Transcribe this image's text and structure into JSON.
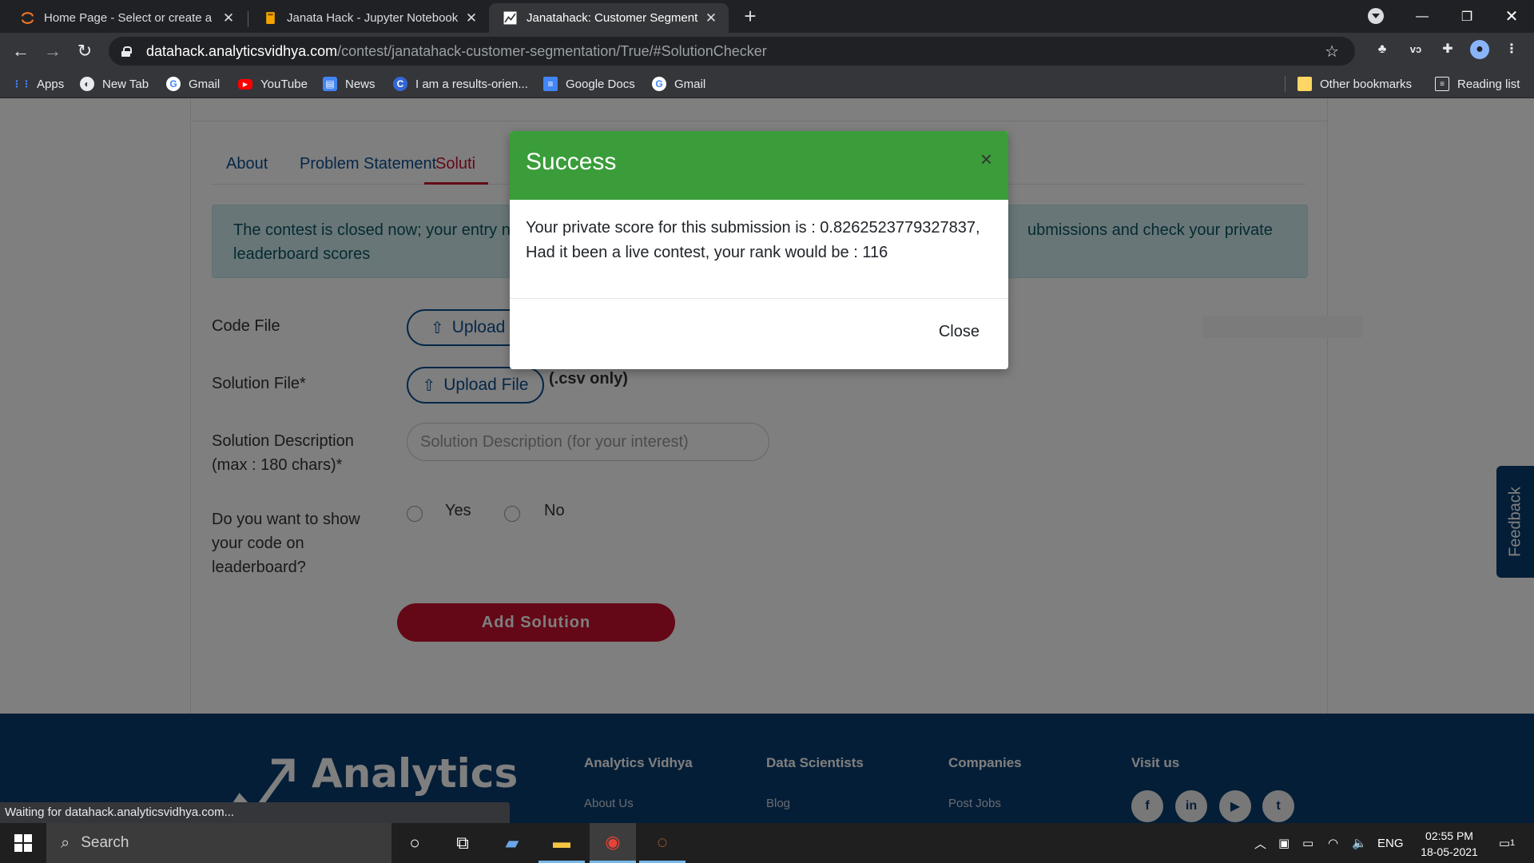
{
  "browser": {
    "tabs": [
      {
        "title": "Home Page - Select or create a n",
        "active": false
      },
      {
        "title": "Janata Hack - Jupyter Notebook",
        "active": false
      },
      {
        "title": "Janatahack: Customer Segmentat",
        "active": true
      }
    ],
    "url_host": "datahack.analyticsvidhya.com",
    "url_path": "/contest/janatahack-customer-segmentation/True/#SolutionChecker",
    "bookmarks": [
      "Apps",
      "New Tab",
      "Gmail",
      "YouTube",
      "News",
      "I am a results-orien...",
      "Google Docs",
      "Gmail"
    ],
    "other_bookmarks": "Other bookmarks",
    "reading_list": "Reading list",
    "status": "Waiting for datahack.analyticsvidhya.com..."
  },
  "page": {
    "tabs": [
      "About",
      "Problem Statement",
      "Soluti"
    ],
    "alert_line1_left": "The contest is closed now; your entry n",
    "alert_line1_right": "ubmissions and check your private",
    "alert_line2": "leaderboard scores",
    "code_file_label": "Code File",
    "solution_file_label": "Solution File*",
    "upload_label": "Upload F",
    "upload_label_full": "Upload File",
    "csv_note": "(.csv only)",
    "desc_label_1": "Solution Description",
    "desc_label_2": "(max : 180 chars)*",
    "desc_placeholder": "Solution Description (for your interest)",
    "show_code_1": "Do you want to show",
    "show_code_2": "your code on",
    "show_code_3": "leaderboard?",
    "yes": "Yes",
    "no": "No",
    "add_solution": "Add Solution",
    "feedback": "Feedback"
  },
  "footer": {
    "logo": "Analytics",
    "columns": [
      {
        "heading": "Analytics Vidhya",
        "link": "About Us"
      },
      {
        "heading": "Data Scientists",
        "link": "Blog"
      },
      {
        "heading": "Companies",
        "link": "Post Jobs"
      },
      {
        "heading": "Visit us",
        "link": ""
      }
    ],
    "social": [
      "f",
      "in",
      "▶",
      "t"
    ]
  },
  "modal": {
    "title": "Success",
    "line1": "Your private score for this submission is : 0.8262523779327837,",
    "line2": "Had it been a live contest, your rank would be : 116",
    "close_label": "Close",
    "header_color": "#3a9d3a"
  },
  "taskbar": {
    "search": "Search",
    "lang": "ENG",
    "time": "02:55 PM",
    "date": "18-05-2021",
    "notifications": "1"
  }
}
